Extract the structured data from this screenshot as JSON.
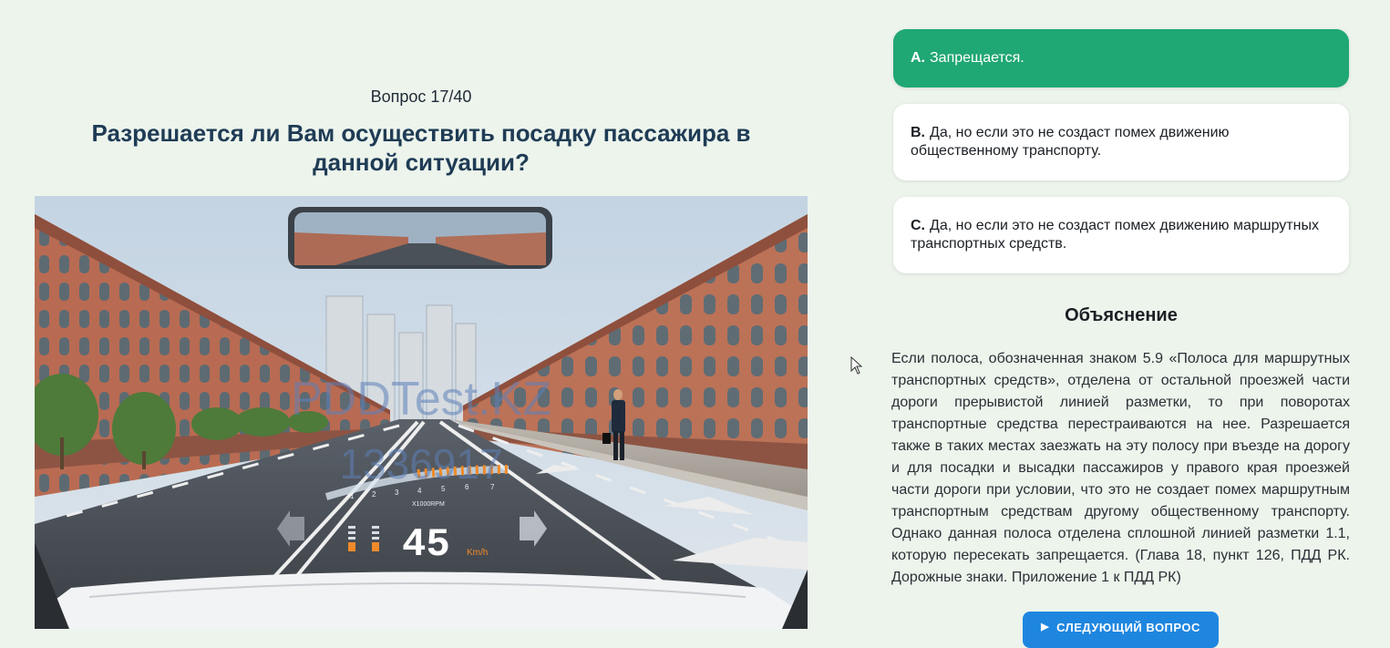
{
  "question": {
    "number_label": "Вопрос 17/40",
    "title": "Разрешается ли Вам осуществить посадку пассажира в данной ситуации?"
  },
  "scene": {
    "watermark_brand": "PDDTest.KZ",
    "watermark_id": "1336917",
    "rpm_label": "X1000RPM",
    "rpm_ticks": [
      "1",
      "2",
      "3",
      "4",
      "5",
      "6",
      "7"
    ],
    "speed": "45",
    "speed_unit": "Km/h"
  },
  "answers": [
    {
      "letter": "A.",
      "text": "Запрещается.",
      "selected": true
    },
    {
      "letter": "B.",
      "text": "Да, но если это не создаст помех движению общественному транспорту.",
      "selected": false
    },
    {
      "letter": "C.",
      "text": "Да, но если это не создаст помех движению маршрутных транспортных средств.",
      "selected": false
    }
  ],
  "explanation": {
    "heading": "Объяснение",
    "text": "Если полоса, обозначенная знаком 5.9 «Полоса для маршрутных транспортных средств», отделена от остальной проезжей части дороги прерывистой линией разметки, то при поворотах транспортные средства перестраиваются на нее. Разрешается также в таких местах заезжать на эту полосу при въезде на дорогу и для посадки и высадки пассажиров у правого края проезжей части дороги при условии, что это не создает помех маршрутным транспортным средствам другому общественному транспорту. Однако данная полоса отделена сплошной линией разметки 1.1, которую пересекать запрещается. (Глава 18, пункт 126, ПДД РК. Дорожные знаки. Приложение 1 к ПДД РК)"
  },
  "next_button": {
    "label": "СЛЕДУЮЩИЙ ВОПРОС"
  },
  "colors": {
    "background": "#ecf4ec",
    "selected_answer": "#1fa774",
    "title": "#1f3b55",
    "button": "#1f86e0"
  }
}
